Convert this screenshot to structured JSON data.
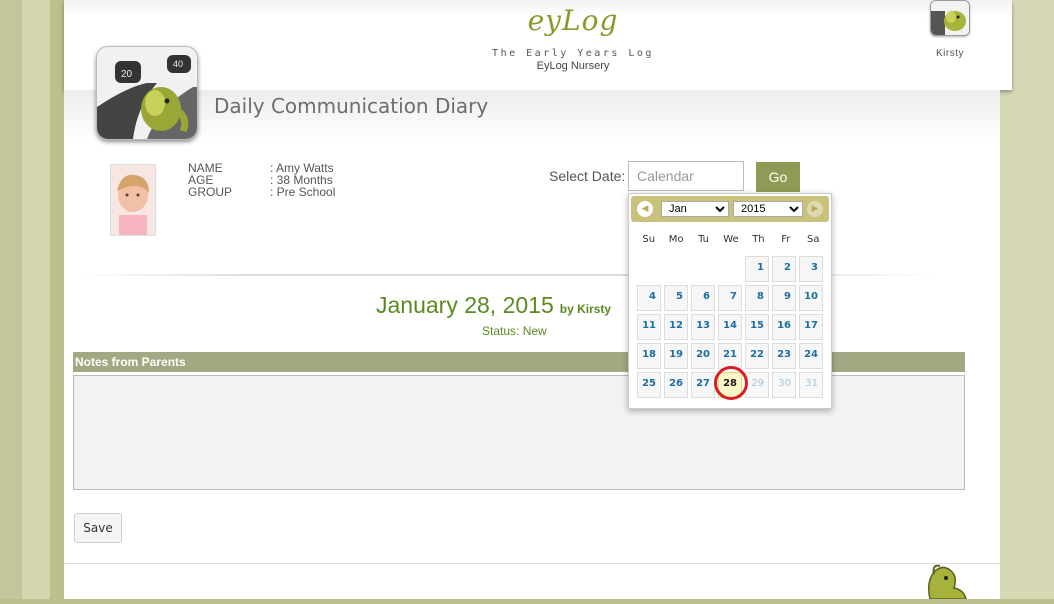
{
  "header": {
    "logo_text": "eyLog",
    "tagline": "The Early Years Log",
    "nursery": "EyLog Nursery",
    "user_name": "Kirsty"
  },
  "page": {
    "title": "Daily Communication Diary"
  },
  "child": {
    "name_label": "NAME",
    "name_value": ": Amy Watts",
    "age_label": "AGE",
    "age_value": ": 38 Months",
    "group_label": "GROUP",
    "group_value": ": Pre School"
  },
  "date_select": {
    "label": "Select Date:",
    "placeholder": "Calendar",
    "go_label": "Go"
  },
  "datepicker": {
    "month": "Jan",
    "year": "2015",
    "days_of_week": [
      "Su",
      "Mo",
      "Tu",
      "We",
      "Th",
      "Fr",
      "Sa"
    ],
    "weeks": [
      [
        "",
        "",
        "",
        "",
        "1",
        "2",
        "3"
      ],
      [
        "4",
        "5",
        "6",
        "7",
        "8",
        "9",
        "10"
      ],
      [
        "11",
        "12",
        "13",
        "14",
        "15",
        "16",
        "17"
      ],
      [
        "18",
        "19",
        "20",
        "21",
        "22",
        "23",
        "24"
      ],
      [
        "25",
        "26",
        "27",
        "28",
        "29",
        "30",
        "31"
      ]
    ],
    "selected_day": "28",
    "disabled_days": [
      "29",
      "30",
      "31"
    ]
  },
  "entry": {
    "date": "January 28, 2015",
    "by": "by Kirsty",
    "status": "Status: New"
  },
  "notes": {
    "title": "Notes from Parents",
    "value": ""
  },
  "actions": {
    "save_label": "Save"
  }
}
